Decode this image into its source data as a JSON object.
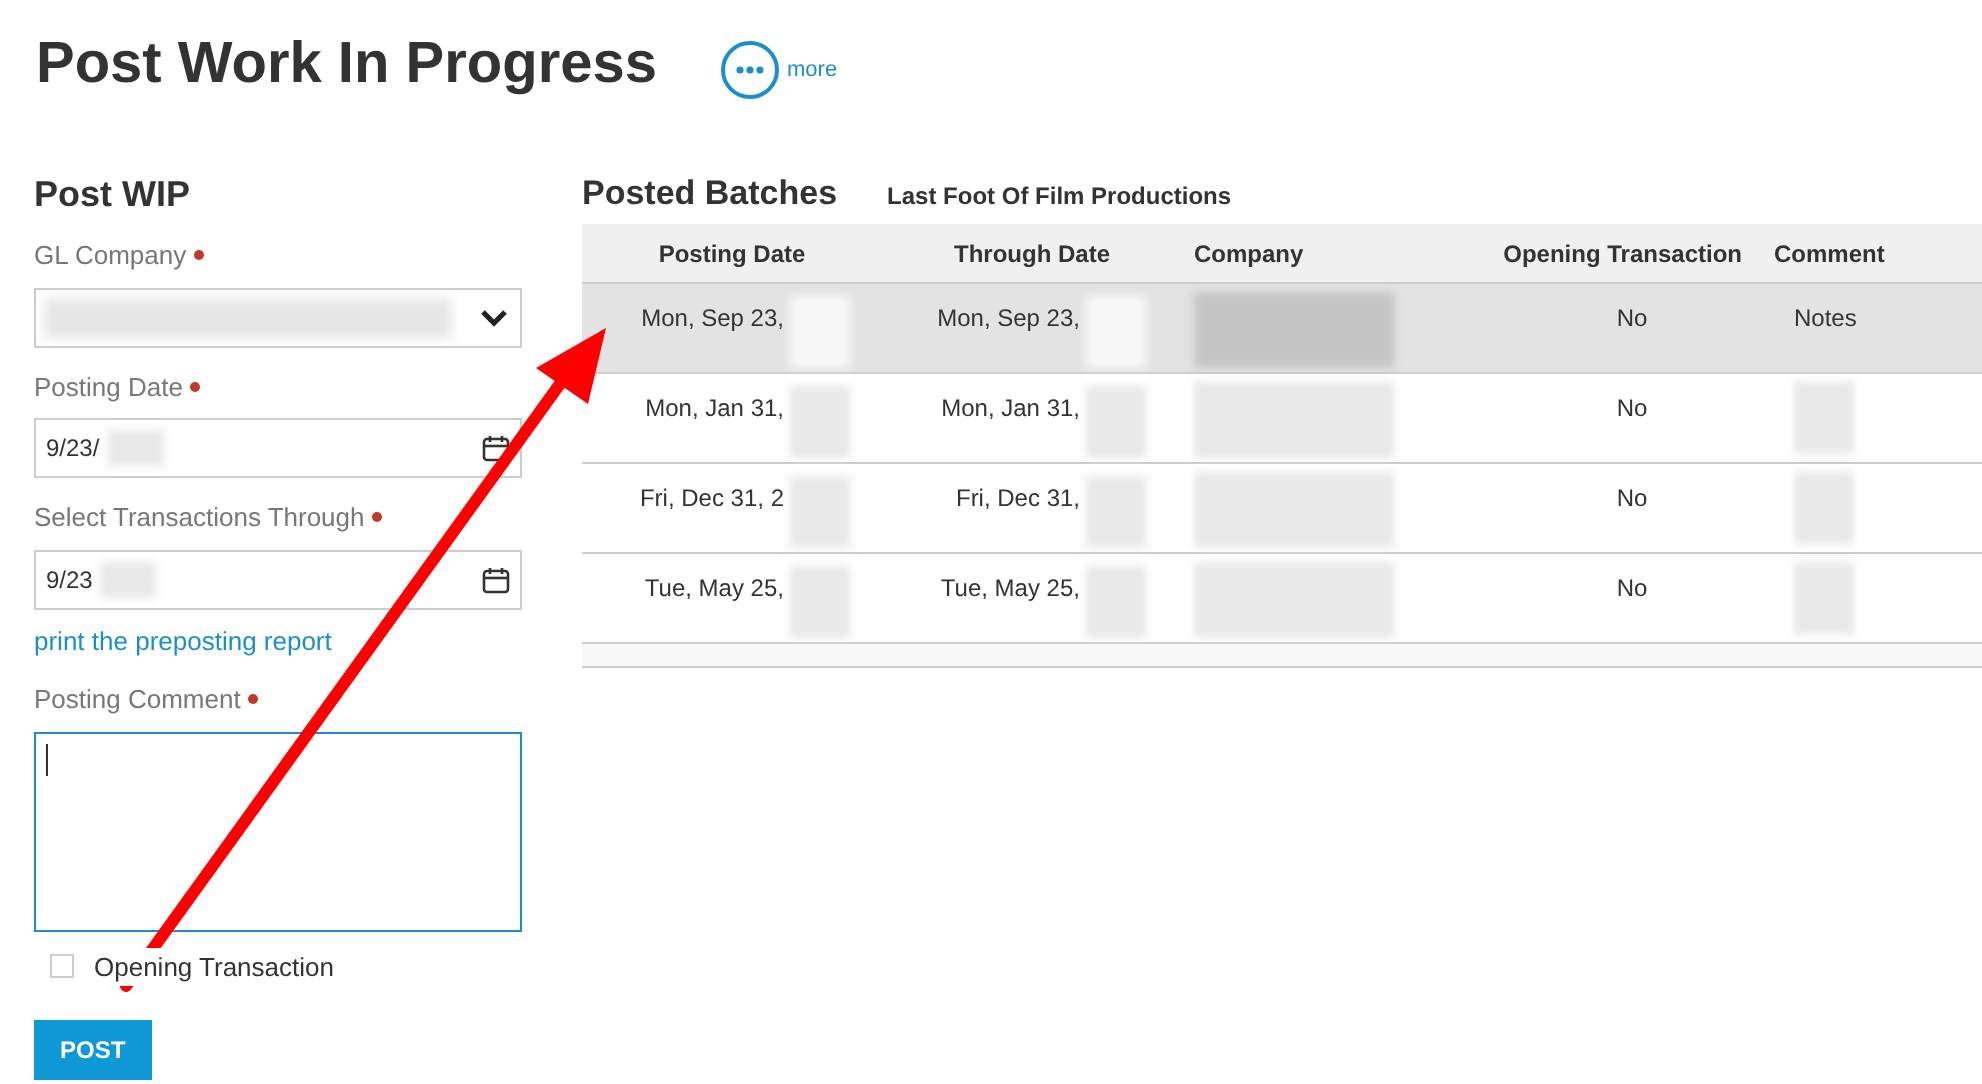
{
  "page_title": "Post Work In Progress",
  "more_button": {
    "label": "more"
  },
  "form": {
    "title": "Post WIP",
    "gl_company": {
      "label": "GL Company",
      "required": true
    },
    "posting_date": {
      "label": "Posting Date",
      "required": true,
      "value": "9/23/"
    },
    "through_date": {
      "label": "Select Transactions Through",
      "required": true,
      "value": "9/23"
    },
    "report_link": "print the preposting report",
    "comment": {
      "label": "Posting Comment",
      "required": true,
      "focused": true
    },
    "opening_transaction": {
      "label": "Opening Transaction",
      "checked": false
    },
    "post_button": "POST"
  },
  "batches": {
    "title": "Posted Batches",
    "subtitle": "Last Foot Of Film Productions",
    "columns": [
      "Posting Date",
      "Through Date",
      "Company",
      "Opening Transaction",
      "Comment"
    ],
    "rows": [
      {
        "posting_date": "Mon, Sep 23,",
        "through_date": "Mon, Sep 23,",
        "opening": "No",
        "comment": "Notes",
        "selected": true
      },
      {
        "posting_date": "Mon, Jan 31,",
        "through_date": "Mon, Jan 31,",
        "opening": "No",
        "selected": false
      },
      {
        "posting_date": "Fri, Dec 31, 2",
        "through_date": "Fri, Dec 31,",
        "opening": "No",
        "selected": false
      },
      {
        "posting_date": "Tue, May 25,",
        "through_date": "Tue, May 25,",
        "opening": "No",
        "selected": false
      }
    ]
  }
}
